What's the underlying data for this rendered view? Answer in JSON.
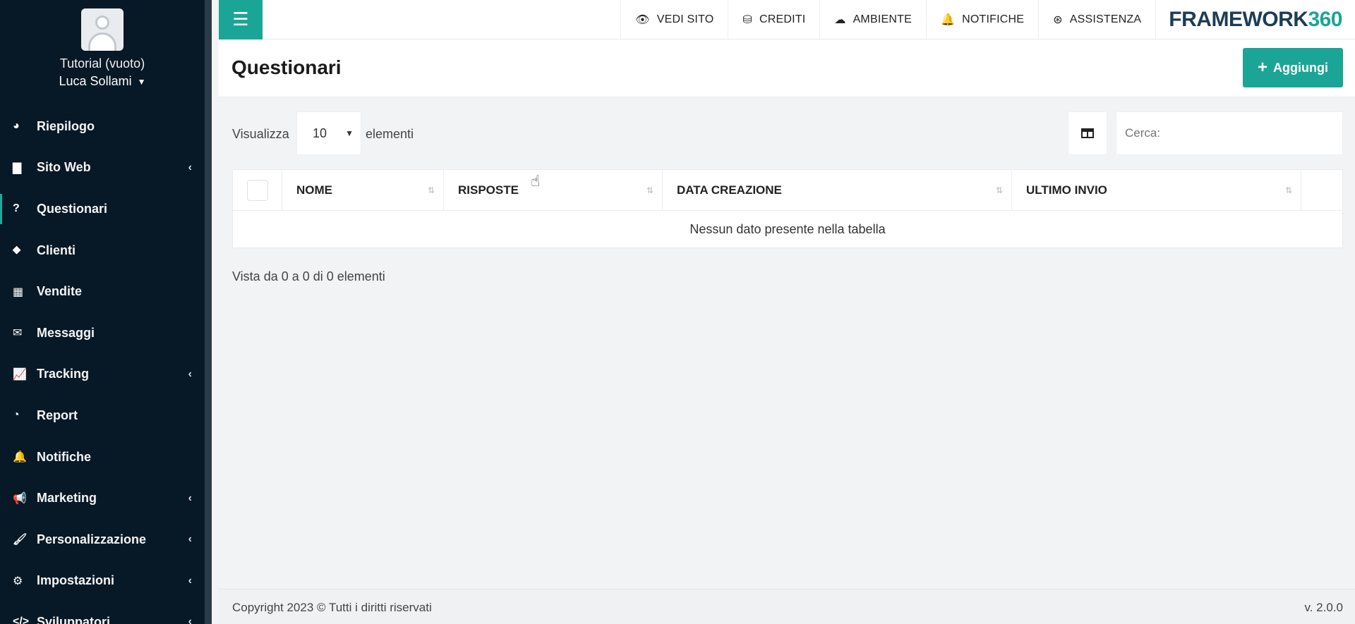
{
  "sidebar": {
    "profile": {
      "subtitle": "Tutorial (vuoto)",
      "name": "Luca Sollami"
    },
    "items": [
      {
        "label": "Riepilogo",
        "icon": "dashboard-icon",
        "glyph": "◕",
        "has_submenu": false
      },
      {
        "label": "Sito Web",
        "icon": "file-icon",
        "glyph": "▇",
        "has_submenu": true
      },
      {
        "label": "Questionari",
        "icon": "question-icon",
        "glyph": "?",
        "has_submenu": false,
        "active": true
      },
      {
        "label": "Clienti",
        "icon": "user-icon",
        "glyph": "⬥",
        "has_submenu": false
      },
      {
        "label": "Vendite",
        "icon": "calculator-icon",
        "glyph": "▦",
        "has_submenu": false
      },
      {
        "label": "Messaggi",
        "icon": "envelope-icon",
        "glyph": "✉",
        "has_submenu": false
      },
      {
        "label": "Tracking",
        "icon": "line-chart-icon",
        "glyph": "📈",
        "has_submenu": true
      },
      {
        "label": "Report",
        "icon": "pie-chart-icon",
        "glyph": "◔",
        "has_submenu": false
      },
      {
        "label": "Notifiche",
        "icon": "bell-icon",
        "glyph": "🔔",
        "has_submenu": false
      },
      {
        "label": "Marketing",
        "icon": "megaphone-icon",
        "glyph": "📢",
        "has_submenu": true
      },
      {
        "label": "Personalizzazione",
        "icon": "brush-icon",
        "glyph": "🖌",
        "has_submenu": true
      },
      {
        "label": "Impostazioni",
        "icon": "gear-icon",
        "glyph": "⚙",
        "has_submenu": true
      },
      {
        "label": "Sviluppatori",
        "icon": "code-icon",
        "glyph": "</>",
        "has_submenu": true
      }
    ]
  },
  "topbar": {
    "links": [
      {
        "label": "VEDI SITO",
        "icon": "eye-icon",
        "glyph": "👁"
      },
      {
        "label": "CREDITI",
        "icon": "coins-icon",
        "glyph": "⛁"
      },
      {
        "label": "AMBIENTE",
        "icon": "cloud-icon",
        "glyph": "☁"
      },
      {
        "label": "NOTIFICHE",
        "icon": "bell-icon",
        "glyph": "🔔"
      },
      {
        "label": "ASSISTENZA",
        "icon": "lifebuoy-icon",
        "glyph": "⊛"
      }
    ],
    "brand": {
      "part1": "FRAMEWORK",
      "part2": "360"
    }
  },
  "page": {
    "title": "Questionari",
    "add_button": "Aggiungi"
  },
  "controls": {
    "show_label": "Visualizza",
    "page_size": "10",
    "show_suffix": "elementi",
    "search_placeholder": "Cerca:"
  },
  "table": {
    "columns": [
      "NOME",
      "RISPOSTE",
      "DATA CREAZIONE",
      "ULTIMO INVIO"
    ],
    "empty_message": "Nessun dato presente nella tabella"
  },
  "info": "Vista da 0 a 0 di 0 elementi",
  "footer": {
    "copyright": "Copyright 2023 © Tutti i diritti riservati",
    "version": "v. 2.0.0"
  },
  "colors": {
    "accent": "#1aa597",
    "sidebar_bg": "#071826",
    "brand_dark": "#1d3c57"
  }
}
